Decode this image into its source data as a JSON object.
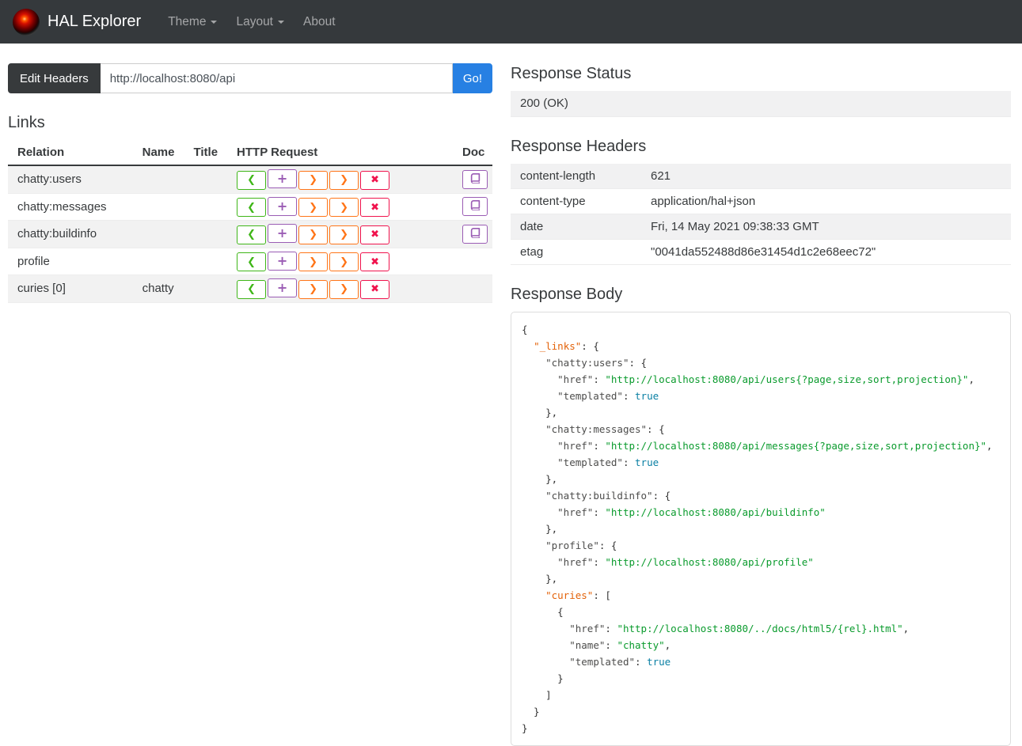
{
  "navbar": {
    "brand": "HAL Explorer",
    "items": [
      {
        "label": "Theme",
        "caret": true
      },
      {
        "label": "Layout",
        "caret": true
      },
      {
        "label": "About",
        "caret": false
      }
    ]
  },
  "request_bar": {
    "edit_headers_label": "Edit Headers",
    "url_value": "http://localhost:8080/api",
    "go_label": "Go!"
  },
  "links_section": {
    "title": "Links",
    "columns": [
      "Relation",
      "Name",
      "Title",
      "HTTP Request",
      "Doc"
    ],
    "http_buttons": [
      {
        "name": "get-button",
        "glyph": "❮",
        "color": "#3fb618"
      },
      {
        "name": "post-button",
        "glyph": "+",
        "color": "#9a5cb4"
      },
      {
        "name": "put-button",
        "glyph": "❯",
        "color": "#ff7518"
      },
      {
        "name": "patch-button",
        "glyph": "❯",
        "color": "#ff7518"
      },
      {
        "name": "delete-button",
        "glyph": "✖",
        "color": "#f0134d"
      }
    ],
    "rows": [
      {
        "relation": "chatty:users",
        "name": "",
        "title": "",
        "doc": true
      },
      {
        "relation": "chatty:messages",
        "name": "",
        "title": "",
        "doc": true
      },
      {
        "relation": "chatty:buildinfo",
        "name": "",
        "title": "",
        "doc": true
      },
      {
        "relation": "profile",
        "name": "",
        "title": "",
        "doc": false
      },
      {
        "relation": "curies [0]",
        "name": "chatty",
        "title": "",
        "doc": false
      }
    ]
  },
  "response_status": {
    "title": "Response Status",
    "value": "200 (OK)"
  },
  "response_headers": {
    "title": "Response Headers",
    "rows": [
      {
        "key": "content-length",
        "value": "621"
      },
      {
        "key": "content-type",
        "value": "application/hal+json"
      },
      {
        "key": "date",
        "value": "Fri, 14 May 2021 09:38:33 GMT"
      },
      {
        "key": "etag",
        "value": "\"0041da552488d86e31454d1c2e68eec72\""
      }
    ]
  },
  "response_body": {
    "title": "Response Body",
    "lines": [
      [
        [
          "{",
          "p"
        ]
      ],
      [
        [
          "  ",
          "p"
        ],
        [
          "\"_links\"",
          "hk"
        ],
        [
          ": {",
          "p"
        ]
      ],
      [
        [
          "    ",
          "p"
        ],
        [
          "\"chatty:users\"",
          "k"
        ],
        [
          ": {",
          "p"
        ]
      ],
      [
        [
          "      ",
          "p"
        ],
        [
          "\"href\"",
          "k"
        ],
        [
          ": ",
          "p"
        ],
        [
          "\"http://localhost:8080/api/users{?page,size,sort,projection}\"",
          "s"
        ],
        [
          ",",
          "p"
        ]
      ],
      [
        [
          "      ",
          "p"
        ],
        [
          "\"templated\"",
          "k"
        ],
        [
          ": ",
          "p"
        ],
        [
          "true",
          "l"
        ]
      ],
      [
        [
          "    },",
          "p"
        ]
      ],
      [
        [
          "    ",
          "p"
        ],
        [
          "\"chatty:messages\"",
          "k"
        ],
        [
          ": {",
          "p"
        ]
      ],
      [
        [
          "      ",
          "p"
        ],
        [
          "\"href\"",
          "k"
        ],
        [
          ": ",
          "p"
        ],
        [
          "\"http://localhost:8080/api/messages{?page,size,sort,projection}\"",
          "s"
        ],
        [
          ",",
          "p"
        ]
      ],
      [
        [
          "      ",
          "p"
        ],
        [
          "\"templated\"",
          "k"
        ],
        [
          ": ",
          "p"
        ],
        [
          "true",
          "l"
        ]
      ],
      [
        [
          "    },",
          "p"
        ]
      ],
      [
        [
          "    ",
          "p"
        ],
        [
          "\"chatty:buildinfo\"",
          "k"
        ],
        [
          ": {",
          "p"
        ]
      ],
      [
        [
          "      ",
          "p"
        ],
        [
          "\"href\"",
          "k"
        ],
        [
          ": ",
          "p"
        ],
        [
          "\"http://localhost:8080/api/buildinfo\"",
          "s"
        ]
      ],
      [
        [
          "    },",
          "p"
        ]
      ],
      [
        [
          "    ",
          "p"
        ],
        [
          "\"profile\"",
          "k"
        ],
        [
          ": {",
          "p"
        ]
      ],
      [
        [
          "      ",
          "p"
        ],
        [
          "\"href\"",
          "k"
        ],
        [
          ": ",
          "p"
        ],
        [
          "\"http://localhost:8080/api/profile\"",
          "s"
        ]
      ],
      [
        [
          "    },",
          "p"
        ]
      ],
      [
        [
          "    ",
          "p"
        ],
        [
          "\"curies\"",
          "hk"
        ],
        [
          ": [",
          "p"
        ]
      ],
      [
        [
          "      {",
          "p"
        ]
      ],
      [
        [
          "        ",
          "p"
        ],
        [
          "\"href\"",
          "k"
        ],
        [
          ": ",
          "p"
        ],
        [
          "\"http://localhost:8080/../docs/html5/{rel}.html\"",
          "s"
        ],
        [
          ",",
          "p"
        ]
      ],
      [
        [
          "        ",
          "p"
        ],
        [
          "\"name\"",
          "k"
        ],
        [
          ": ",
          "p"
        ],
        [
          "\"chatty\"",
          "s"
        ],
        [
          ",",
          "p"
        ]
      ],
      [
        [
          "        ",
          "p"
        ],
        [
          "\"templated\"",
          "k"
        ],
        [
          ": ",
          "p"
        ],
        [
          "true",
          "l"
        ]
      ],
      [
        [
          "      }",
          "p"
        ]
      ],
      [
        [
          "    ]",
          "p"
        ]
      ],
      [
        [
          "  }",
          "p"
        ]
      ],
      [
        [
          "}",
          "p"
        ]
      ]
    ]
  },
  "colors": {
    "navbar_bg": "#35393c",
    "primary": "#2780e3",
    "get_green": "#3fb618",
    "post_purple": "#9a5cb4",
    "put_patch_orange": "#ff7518",
    "delete_red": "#f0134d",
    "stripe": "#f2f2f2",
    "json_key_highlight": "#e36209",
    "json_string": "#0a9b2d",
    "json_literal": "#0b80a4"
  }
}
